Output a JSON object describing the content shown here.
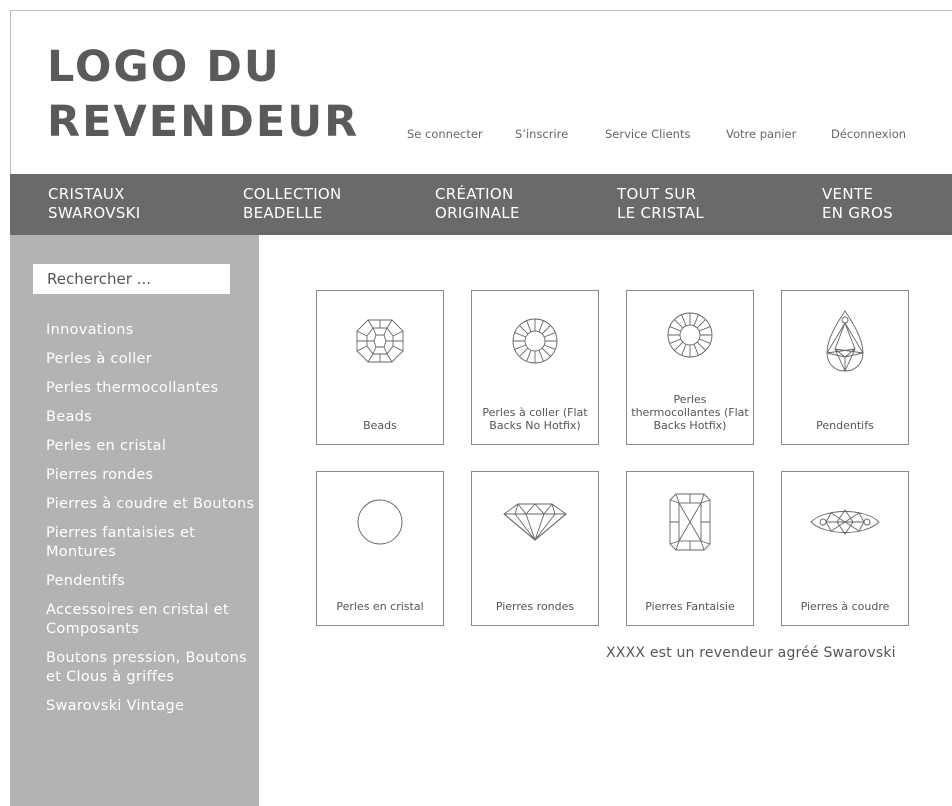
{
  "logo": {
    "line1": "LOGO DU",
    "line2": "REVENDEUR"
  },
  "user_nav": [
    "Se connecter",
    "S’inscrire",
    "Service Clients",
    "Votre panier",
    "Déconnexion"
  ],
  "main_nav": [
    {
      "line1": "CRISTAUX",
      "line2": "SWAROVSKI"
    },
    {
      "line1": "COLLECTION",
      "line2": "BEADELLE"
    },
    {
      "line1": "CRÉATION",
      "line2": "ORIGINALE"
    },
    {
      "line1": "TOUT SUR",
      "line2": "LE CRISTAL"
    },
    {
      "line1": "VENTE",
      "line2": "EN GROS"
    }
  ],
  "search": {
    "placeholder": "Rechercher ..."
  },
  "sidebar_categories": [
    "Innovations",
    "Perles à coller",
    "Perles thermocollantes",
    "Beads",
    "Perles en cristal",
    "Pierres rondes",
    "Pierres à coudre et Boutons",
    "Pierres fantaisies et Montures",
    "Pendentifs",
    "Accessoires en cristal et Composants",
    "Boutons pression, Boutons et Clous à griffes",
    "Swarovski Vintage"
  ],
  "products": [
    {
      "label": "Beads",
      "icon": "faceted-bead-icon"
    },
    {
      "label": "Perles à coller (Flat Backs No Hotfix)",
      "icon": "flat-back-icon"
    },
    {
      "label": "Perles thermocollantes (Flat Backs Hotfix)",
      "icon": "flat-back-hotfix-icon"
    },
    {
      "label": "Pendentifs",
      "icon": "pendant-icon"
    },
    {
      "label": "Perles en cristal",
      "icon": "round-pearl-icon"
    },
    {
      "label": "Pierres rondes",
      "icon": "round-stone-icon"
    },
    {
      "label": "Pierres Fantaisie",
      "icon": "fancy-stone-icon"
    },
    {
      "label": "Pierres à coudre",
      "icon": "sew-on-stone-icon"
    }
  ],
  "dealer_notice": "XXXX est un revendeur agréé Swarovski",
  "colors": {
    "nav_bar": "#6a6a6a",
    "sidebar": "#b3b3b3",
    "logo": "#5a5a5a"
  }
}
